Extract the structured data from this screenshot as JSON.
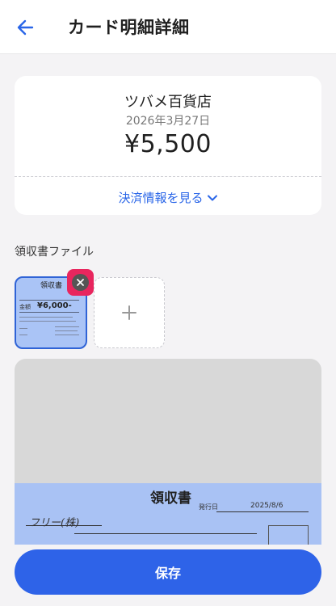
{
  "header": {
    "title": "カード明細詳細"
  },
  "transaction": {
    "store": "ツバメ百貨店",
    "date": "2026年3月27日",
    "amount": "¥5,500",
    "payment_info_label": "決済情報を見る"
  },
  "receipt_files": {
    "section_label": "領収書ファイル",
    "thumbnail": {
      "title": "領収書",
      "amount_label": "金額",
      "amount": "¥6,000-"
    }
  },
  "preview": {
    "title": "領収書",
    "issued_label": "発行日",
    "issued_date": "2025/8/6",
    "recipient": "フリー(株)"
  },
  "actions": {
    "save_label": "保存"
  },
  "colors": {
    "accent": "#2e63e8",
    "highlight": "#e8265e"
  }
}
